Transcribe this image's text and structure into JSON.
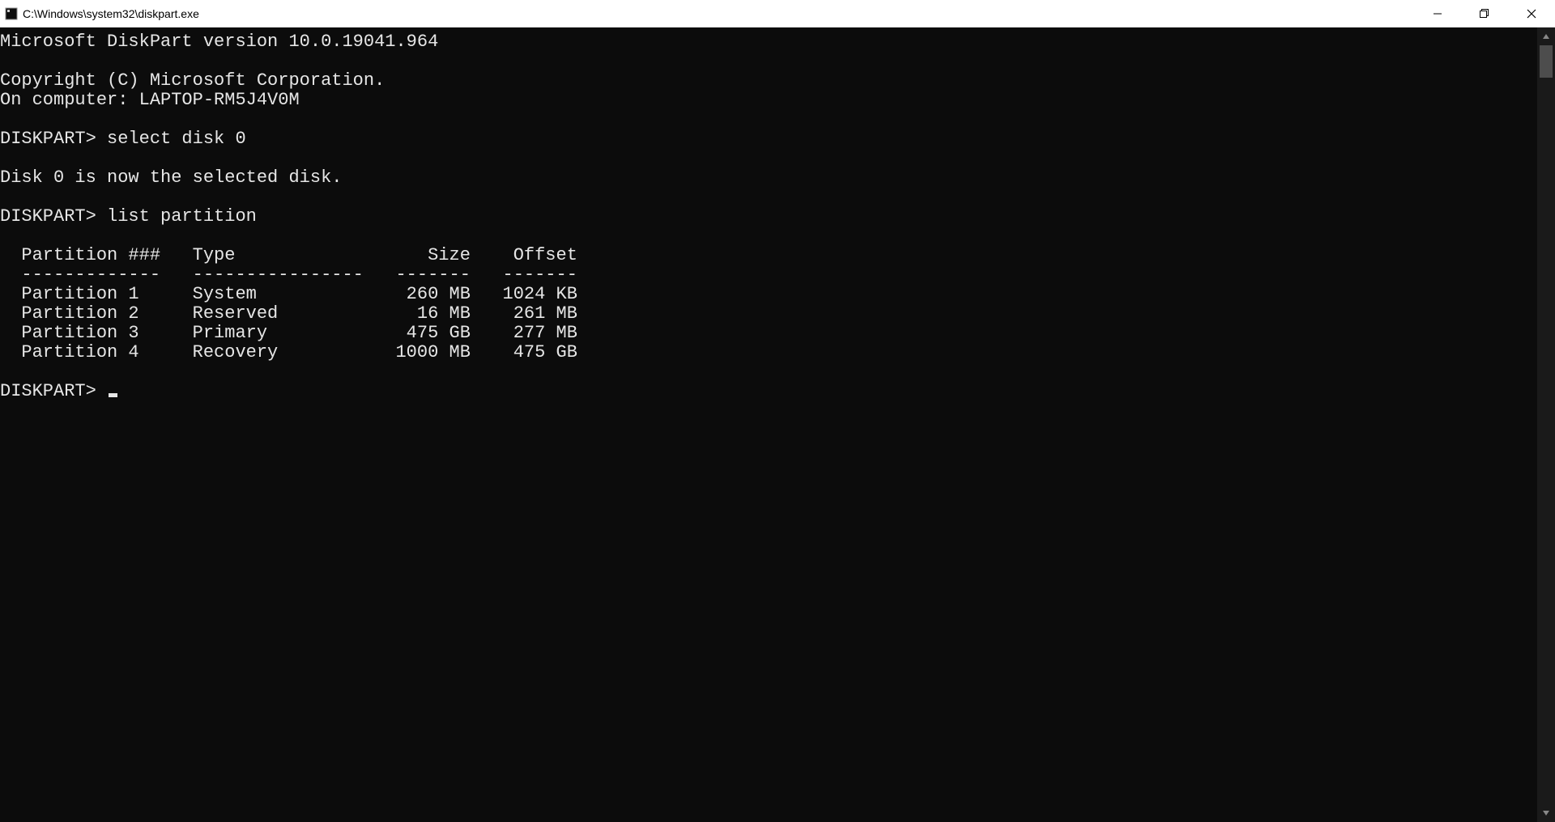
{
  "titlebar": {
    "path": "C:\\Windows\\system32\\diskpart.exe"
  },
  "terminal": {
    "header_version": "Microsoft DiskPart version 10.0.19041.964",
    "copyright": "Copyright (C) Microsoft Corporation.",
    "on_computer_label": "On computer: ",
    "on_computer_value": "LAPTOP-RM5J4V0M",
    "prompt": "DISKPART>",
    "cmd1": "select disk 0",
    "cmd1_result": "Disk 0 is now the selected disk.",
    "cmd2": "list partition",
    "table": {
      "headers": {
        "col1": "Partition ###",
        "col2": "Type",
        "col3": "Size",
        "col4": "Offset"
      },
      "divider": {
        "col1": "-------------",
        "col2": "----------------",
        "col3": "-------",
        "col4": "-------"
      },
      "rows": [
        {
          "p": "Partition 1",
          "type": "System",
          "size": "260 MB",
          "offset": "1024 KB"
        },
        {
          "p": "Partition 2",
          "type": "Reserved",
          "size": "16 MB",
          "offset": "261 MB"
        },
        {
          "p": "Partition 3",
          "type": "Primary",
          "size": "475 GB",
          "offset": "277 MB"
        },
        {
          "p": "Partition 4",
          "type": "Recovery",
          "size": "1000 MB",
          "offset": "475 GB"
        }
      ]
    }
  }
}
